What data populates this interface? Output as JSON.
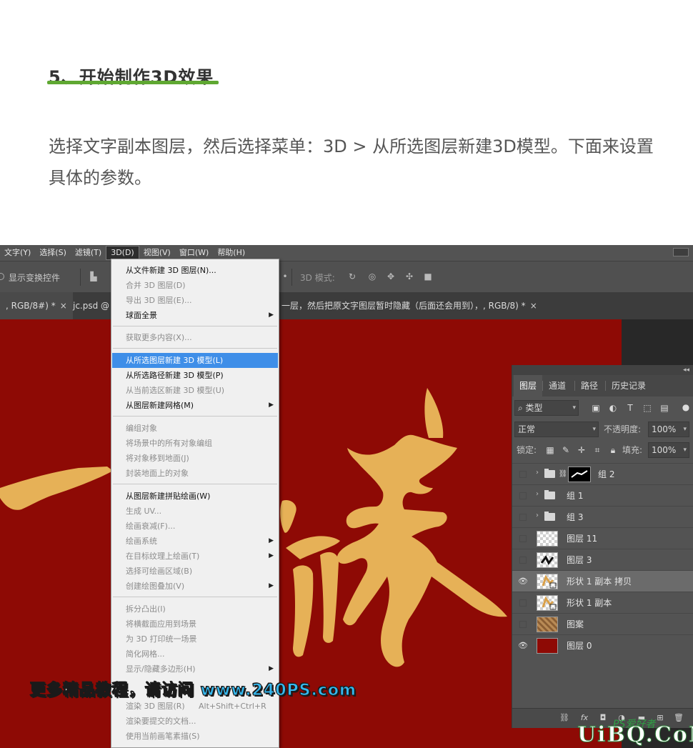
{
  "article": {
    "heading": "5、开始制作3D效果",
    "paragraph": "选择文字副本图层，然后选择菜单：3D > 从所选图层新建3D模型。下面来设置具体的参数。"
  },
  "menubar": {
    "items": [
      "文字(Y)",
      "选择(S)",
      "滤镜(T)",
      "3D(D)",
      "视图(V)",
      "窗口(W)",
      "帮助(H)"
    ]
  },
  "options": {
    "show_transform": "显示变换控件",
    "mode_label": "3D 模式:"
  },
  "tabs": {
    "doc1": ", RGB/8#) *",
    "doc2": "jc.psd @",
    "doc3": "一层，然后把原文字图层暂时隐藏（后面还会用到），, RGB/8) *",
    "close": "×"
  },
  "menu_3d": {
    "items": [
      {
        "label": "从文件新建 3D 图层(N)...",
        "disabled": false
      },
      {
        "label": "合并 3D 图层(D)",
        "disabled": true
      },
      {
        "label": "导出 3D 图层(E)...",
        "disabled": true
      },
      {
        "label": "球面全景",
        "disabled": false,
        "submenu": true
      },
      {
        "label": "获取更多内容(X)...",
        "disabled": true
      },
      {
        "label": "从所选图层新建 3D 模型(L)",
        "disabled": false,
        "highlighted": true
      },
      {
        "label": "从所选路径新建 3D 模型(P)",
        "disabled": false
      },
      {
        "label": "从当前选区新建 3D 模型(U)",
        "disabled": true
      },
      {
        "label": "从图层新建网格(M)",
        "disabled": false,
        "submenu": true
      },
      {
        "label": "编组对象",
        "disabled": true
      },
      {
        "label": "将场景中的所有对象编组",
        "disabled": true
      },
      {
        "label": "将对象移到地面(J)",
        "disabled": true
      },
      {
        "label": "封装地面上的对象",
        "disabled": true
      },
      {
        "label": "从图层新建拼贴绘画(W)",
        "disabled": false
      },
      {
        "label": "生成 UV...",
        "disabled": true
      },
      {
        "label": "绘画衰减(F)...",
        "disabled": true
      },
      {
        "label": "绘画系统",
        "disabled": true,
        "submenu": true
      },
      {
        "label": "在目标纹理上绘画(T)",
        "disabled": true,
        "submenu": true
      },
      {
        "label": "选择可绘画区域(B)",
        "disabled": true
      },
      {
        "label": "创建绘图叠加(V)",
        "disabled": true,
        "submenu": true
      },
      {
        "label": "拆分凸出(I)",
        "disabled": true
      },
      {
        "label": "将横截面应用到场景",
        "disabled": true
      },
      {
        "label": "为 3D 打印统一场景",
        "disabled": true
      },
      {
        "label": "简化网格...",
        "disabled": true
      },
      {
        "label": "显示/隐藏多边形(H)",
        "disabled": true,
        "submenu": true
      },
      {
        "label": "渲染 3D 图层(R)",
        "disabled": true,
        "shortcut": "Alt+Shift+Ctrl+R"
      },
      {
        "label": "渲染要提交的文档...",
        "disabled": true
      },
      {
        "label": "使用当前画笔素描(S)",
        "disabled": true
      }
    ]
  },
  "canvas": {
    "background": "#8e0a05",
    "text_color": "#e6b157"
  },
  "layers_panel": {
    "collapse": "◂◂",
    "tabs": [
      "图层",
      "通道",
      "路径",
      "历史记录"
    ],
    "filter_kind": "类型",
    "blend_mode": "正常",
    "opacity_label": "不透明度:",
    "opacity_value": "100%",
    "lock_label": "锁定:",
    "fill_label": "填充:",
    "fill_value": "100%",
    "layers": [
      {
        "name": "组 2",
        "type": "group",
        "visible": false,
        "selected": false
      },
      {
        "name": "组 1",
        "type": "group",
        "visible": false,
        "selected": false
      },
      {
        "name": "组 3",
        "type": "group",
        "visible": false,
        "selected": false
      },
      {
        "name": "图层 11",
        "type": "layer",
        "visible": false,
        "selected": false
      },
      {
        "name": "图层 3",
        "type": "layer",
        "visible": false,
        "selected": false
      },
      {
        "name": "形状 1 副本 拷贝",
        "type": "shape",
        "visible": true,
        "selected": true
      },
      {
        "name": "形状 1 副本",
        "type": "shape",
        "visible": false,
        "selected": false
      },
      {
        "name": "图案",
        "type": "pattern",
        "visible": false,
        "selected": false
      },
      {
        "name": "图层 0",
        "type": "fill",
        "visible": true,
        "selected": false
      }
    ]
  },
  "watermark": {
    "prefix": "更多精品教程，请访问 ",
    "url": "www.240PS.com"
  },
  "corner_logo": {
    "main": "UiBQ.CoM",
    "sub": "PS爱好者"
  }
}
